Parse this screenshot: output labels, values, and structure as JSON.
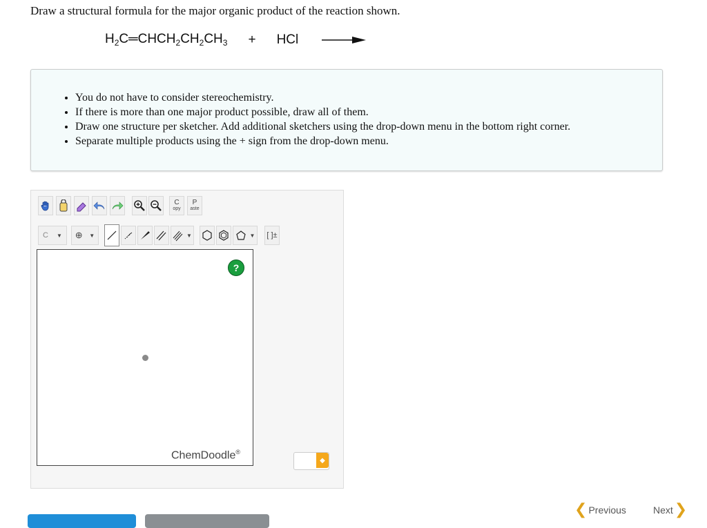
{
  "question": "Draw a structural formula for the major organic product of the reaction shown.",
  "reaction": {
    "reactant1_parts": [
      "H",
      "2",
      "C═CHCH",
      "2",
      "CH",
      "2",
      "CH",
      "3"
    ],
    "plus": "+",
    "reactant2": "HCl"
  },
  "instructions": [
    "You do not have to consider stereochemistry.",
    "If there is more than one major product possible, draw all of them.",
    "Draw one structure per sketcher. Add additional sketchers using the drop-down menu in the bottom right corner.",
    "Separate multiple products using the + sign from the drop-down menu."
  ],
  "toolbar": {
    "copy_top": "C",
    "copy_bottom": "opy",
    "paste_top": "P",
    "paste_bottom": "aste",
    "element": "C",
    "charge": "⊕",
    "bracket": "[ ]±"
  },
  "canvas": {
    "help": "?",
    "brand": "ChemDoodle",
    "brand_mark": "®"
  },
  "nav": {
    "previous": "Previous",
    "next": "Next"
  },
  "colors": {
    "accent": "#e0a31c",
    "help": "#1a9e3e",
    "blue_button": "#1f8ed8"
  }
}
